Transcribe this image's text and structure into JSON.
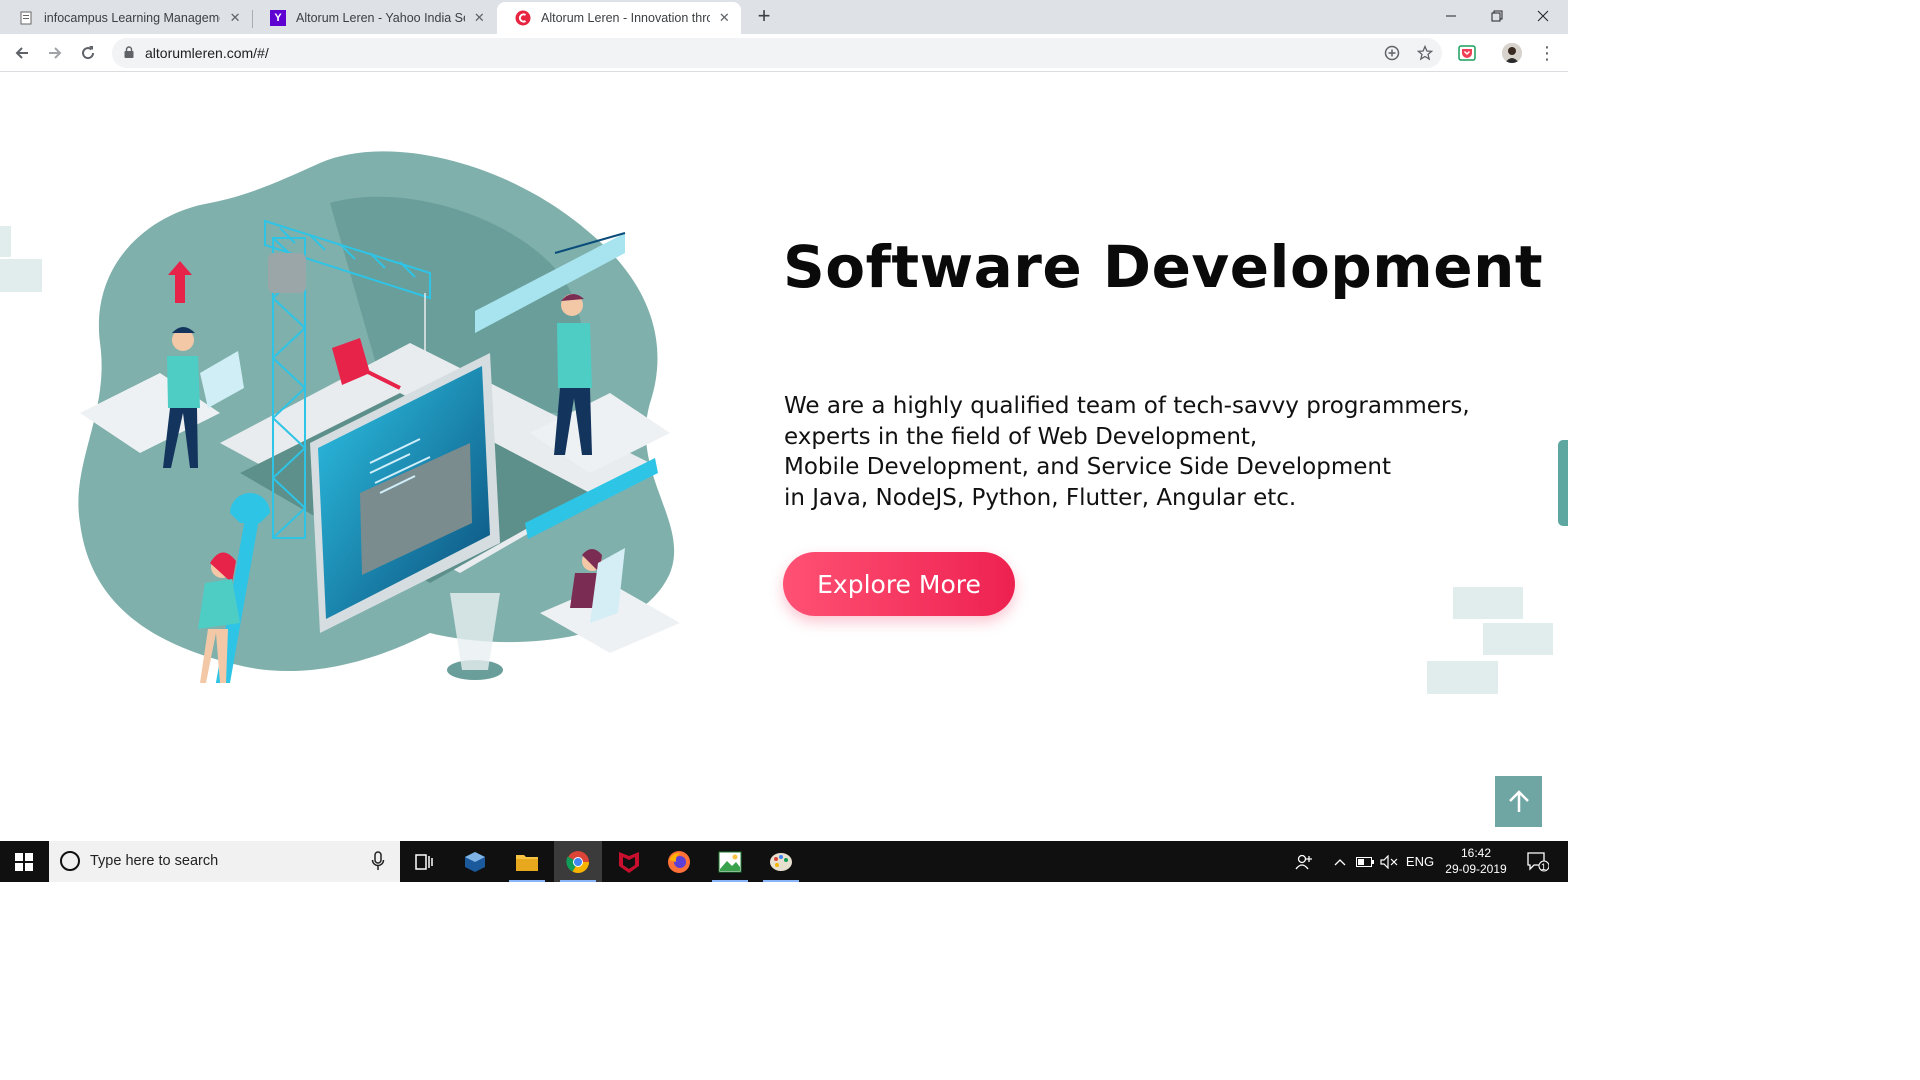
{
  "browser": {
    "tabs": [
      {
        "title": "infocampus Learning Manageme",
        "close": "✕",
        "active": false
      },
      {
        "title": "Altorum Leren - Yahoo India Sear",
        "close": "✕",
        "active": false
      },
      {
        "title": "Altorum Leren - Innovation throu",
        "close": "✕",
        "active": true
      }
    ],
    "new_tab": "+",
    "url": "altorumleren.com/#/"
  },
  "page": {
    "title": "Software Development",
    "description_lines": [
      "We are a highly qualified team of tech-savvy programmers,",
      "experts in the field of Web Development,",
      "Mobile Development, and Service Side Development",
      "in Java, NodeJS, Python, Flutter, Angular etc."
    ],
    "cta_label": "Explore More",
    "colors": {
      "accent": "#f0325a",
      "teal": "#6fa6a4",
      "illustration_bg": "#7fb0ac"
    }
  },
  "taskbar": {
    "search_placeholder": "Type here to search",
    "language": "ENG",
    "time": "16:42",
    "date": "29-09-2019",
    "notification_count": "1"
  }
}
